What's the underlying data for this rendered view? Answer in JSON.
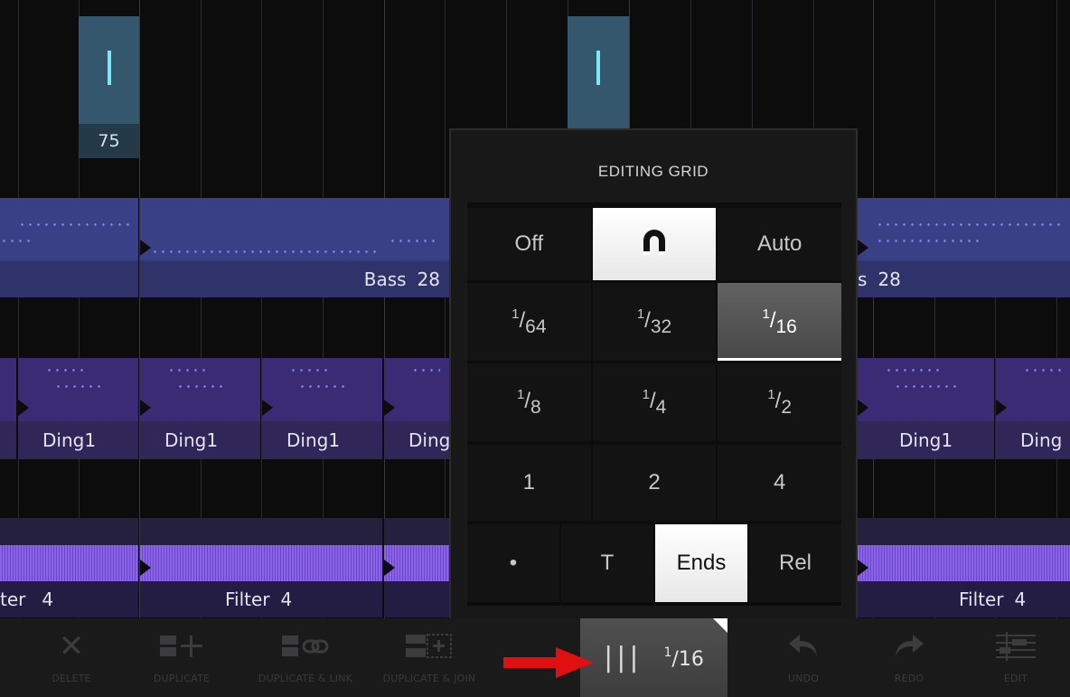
{
  "note_clips": [
    {
      "value": "75"
    },
    {
      "value": ""
    }
  ],
  "tracks": {
    "bass": [
      {
        "name": "",
        "num": ""
      },
      {
        "name": "Bass",
        "num": "28"
      },
      {
        "name": "s",
        "num": "28"
      }
    ],
    "ding": [
      {
        "name": "Ding",
        "num": "1"
      },
      {
        "name": "Ding",
        "num": "1"
      },
      {
        "name": "Ding",
        "num": "1"
      },
      {
        "name": "Ding",
        "num": ""
      },
      {
        "name": "Ding",
        "num": "1"
      },
      {
        "name": "Ding",
        "num": ""
      }
    ],
    "filter": [
      {
        "name": "ter",
        "num": "4"
      },
      {
        "name": "Filter",
        "num": "4"
      },
      {
        "name": "",
        "num": ""
      },
      {
        "name": "Filter",
        "num": "4"
      }
    ]
  },
  "editing_grid": {
    "title": "EDITING GRID",
    "mode_row": {
      "off": "Off",
      "magnet_icon": "magnet-icon",
      "auto": "Auto",
      "selected": "magnet"
    },
    "row1": [
      {
        "num": "1",
        "den": "64"
      },
      {
        "num": "1",
        "den": "32"
      },
      {
        "num": "1",
        "den": "16"
      }
    ],
    "row1_selected": "1/16",
    "row2": [
      {
        "num": "1",
        "den": "8"
      },
      {
        "num": "1",
        "den": "4"
      },
      {
        "num": "1",
        "den": "2"
      }
    ],
    "row3": [
      "1",
      "2",
      "4"
    ],
    "row4": {
      "dot": "•",
      "t": "T",
      "ends": "Ends",
      "rel": "Rel",
      "selected": "Ends"
    }
  },
  "toolbar": {
    "delete": "DELETE",
    "duplicate": "DUPLICATE",
    "duplicate_link": "DUPLICATE & LINK",
    "duplicate_join": "DUPLICATE & JOIN",
    "grid_bars": "|||",
    "grid_num": "1",
    "grid_den": "16",
    "undo": "UNDO",
    "redo": "REDO",
    "edit": "EDIT"
  },
  "colors": {
    "accent_arrow": "#e01010",
    "note_bar": "#7be8f5"
  }
}
